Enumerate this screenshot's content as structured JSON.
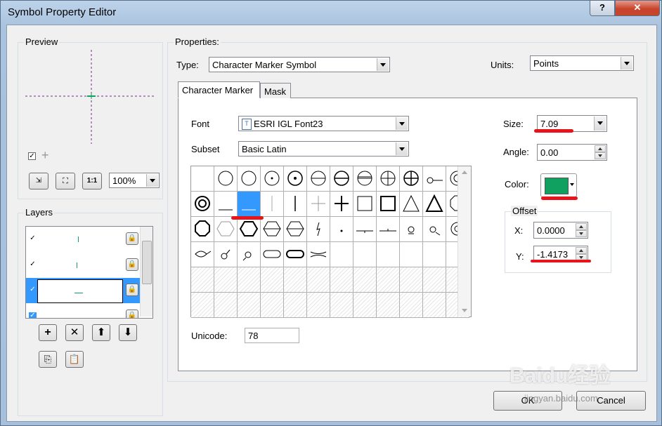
{
  "window": {
    "title": "Symbol Property Editor",
    "help_label": "?",
    "close_label": "✕"
  },
  "preview": {
    "label": "Preview",
    "zoom": "100%",
    "checkbox_checked": true
  },
  "layers": {
    "label": "Layers",
    "rows": [
      {
        "checked": true,
        "selected": false
      },
      {
        "checked": true,
        "selected": false
      },
      {
        "checked": true,
        "selected": true
      },
      {
        "checked": true,
        "selected": false
      }
    ]
  },
  "properties": {
    "label": "Properties:",
    "type_label": "Type:",
    "type_value": "Character Marker Symbol",
    "units_label": "Units:",
    "units_value": "Points",
    "tabs": [
      "Character Marker",
      "Mask"
    ],
    "font_label": "Font",
    "font_value": "ESRI IGL Font23",
    "subset_label": "Subset",
    "subset_value": "Basic Latin",
    "unicode_label": "Unicode:",
    "unicode_value": "78",
    "size_label": "Size:",
    "size_value": "7.09",
    "angle_label": "Angle:",
    "angle_value": "0.00",
    "color_label": "Color:",
    "color_value": "#10a060",
    "offset_label": "Offset",
    "x_label": "X:",
    "x_value": "0.0000",
    "y_label": "Y:",
    "y_value": "-1.4173"
  },
  "buttons": {
    "ok": "OK",
    "cancel": "Cancel"
  },
  "watermark": {
    "text": "Baidu经验",
    "sub": "jingyan.baidu.com"
  }
}
